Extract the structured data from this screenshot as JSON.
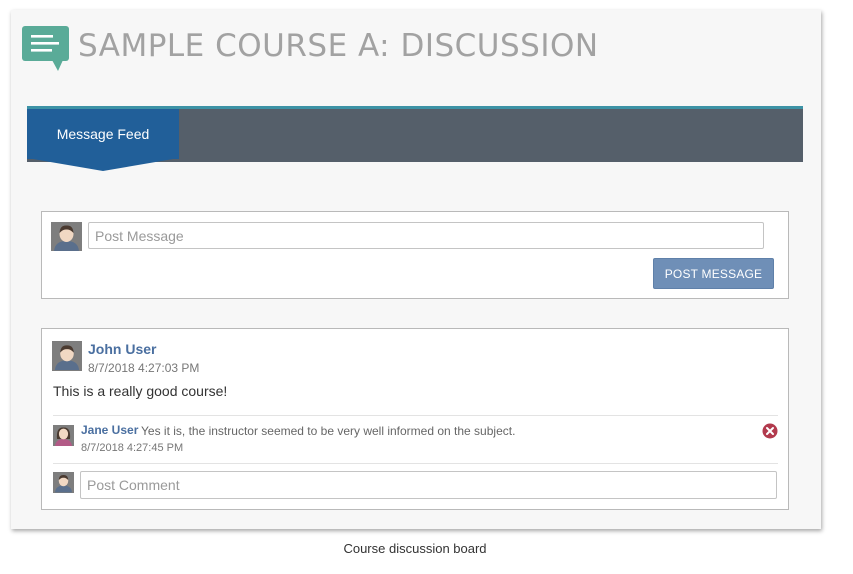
{
  "header": {
    "title": "SAMPLE COURSE A: DISCUSSION",
    "icon": "discussion-chat-icon",
    "icon_color": "#5aab98"
  },
  "tabs": [
    {
      "label": "Message Feed",
      "active": true
    }
  ],
  "composer": {
    "placeholder": "Post Message",
    "value": "",
    "button_label": "POST MESSAGE"
  },
  "feed": [
    {
      "author": "John User",
      "timestamp": "8/7/2018 4:27:03 PM",
      "text": "This is a really good course!",
      "comments": [
        {
          "author": "Jane User",
          "text": "Yes it is, the instructor seemed to be very well informed on the subject.",
          "timestamp": "8/7/2018 4:27:45 PM"
        }
      ],
      "comment_placeholder": "Post Comment"
    }
  ],
  "caption": "Course discussion board",
  "colors": {
    "tab_active": "#215f99",
    "tabbar": "#555f6a",
    "tabbar_accent": "#3d93a6",
    "button": "#6f8fb7",
    "link": "#4a6fa0",
    "delete": "#b23a4d"
  }
}
